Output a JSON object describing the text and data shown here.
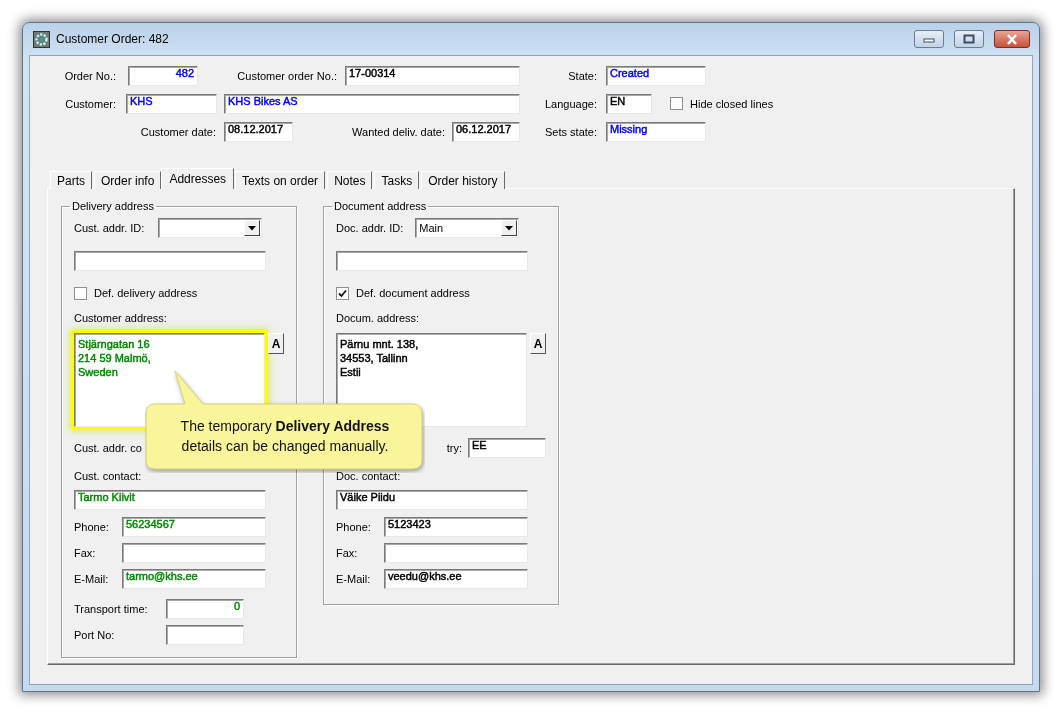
{
  "window": {
    "title": "Customer Order: 482"
  },
  "header": {
    "order_no": {
      "label": "Order No.:",
      "value": "482",
      "color": "#0000ff"
    },
    "customer_order_no": {
      "label": "Customer order No.:",
      "value": "17-00314",
      "color": "#000000"
    },
    "state": {
      "label": "State:",
      "value": "Created",
      "color": "#0000ff"
    },
    "customer": {
      "label": "Customer:",
      "code": "KHS",
      "name": "KHS Bikes AS",
      "color": "#0000ff"
    },
    "language": {
      "label": "Language:",
      "value": "EN",
      "color": "#000000"
    },
    "hide_closed_lines": {
      "label": "Hide closed lines",
      "checked": false
    },
    "customer_date": {
      "label": "Customer date:",
      "value": "08.12.2017",
      "color": "#000000"
    },
    "wanted_deliv_date": {
      "label": "Wanted deliv. date:",
      "value": "06.12.2017",
      "color": "#000000"
    },
    "sets_state": {
      "label": "Sets state:",
      "value": "Missing",
      "color": "#0000ff"
    }
  },
  "tabs": [
    {
      "label": "Parts",
      "selected": false
    },
    {
      "label": "Order info",
      "selected": false
    },
    {
      "label": "Addresses",
      "selected": true
    },
    {
      "label": "Texts on order",
      "selected": false
    },
    {
      "label": "Notes",
      "selected": false
    },
    {
      "label": "Tasks",
      "selected": false
    },
    {
      "label": "Order history",
      "selected": false
    }
  ],
  "delivery_address": {
    "title": "Delivery address",
    "addr_id": {
      "label": "Cust. addr. ID:"
    },
    "default": {
      "label": "Def. delivery address",
      "checked": false
    },
    "address": {
      "label": "Customer address:",
      "value": "Stjärngatan 16\n214 59 Malmö,\nSweden",
      "color": "#008a00",
      "highlighted": true
    },
    "address_button": {
      "label": "A"
    },
    "country": {
      "label": "Cust. addr. co"
    },
    "contact": {
      "label": "Cust. contact:",
      "value": "Tarmo Kiivit",
      "color": "#008a00"
    },
    "phone": {
      "label": "Phone:",
      "value": "56234567",
      "color": "#008a00"
    },
    "fax": {
      "label": "Fax:"
    },
    "email": {
      "label": "E-Mail:",
      "value": "tarmo@khs.ee",
      "color": "#008a00"
    },
    "transport_time": {
      "label": "Transport time:",
      "value": "0",
      "color": "#008a00"
    },
    "port_no": {
      "label": "Port No:"
    }
  },
  "document_address": {
    "title": "Document address",
    "addr_id": {
      "label": "Doc. addr. ID:",
      "value": "Main"
    },
    "default": {
      "label": "Def. document address",
      "checked": true
    },
    "address": {
      "label": "Docum. address:",
      "value": "Pärnu mnt. 138,\n34553, Tallinn\nEstii",
      "color": "#000000",
      "highlighted": false
    },
    "address_button": {
      "label": "A"
    },
    "country": {
      "label": "try:",
      "value": "EE",
      "color": "#000000"
    },
    "contact": {
      "label": "Doc. contact:",
      "value": "Väike Piidu",
      "color": "#000000"
    },
    "phone": {
      "label": "Phone:",
      "value": "5123423",
      "color": "#000000"
    },
    "fax": {
      "label": "Fax:"
    },
    "email": {
      "label": "E-Mail:",
      "value": "veedu@khs.ee",
      "color": "#000000"
    }
  },
  "callout": {
    "text": "The temporary **Delivery Address** details can be changed manually."
  }
}
